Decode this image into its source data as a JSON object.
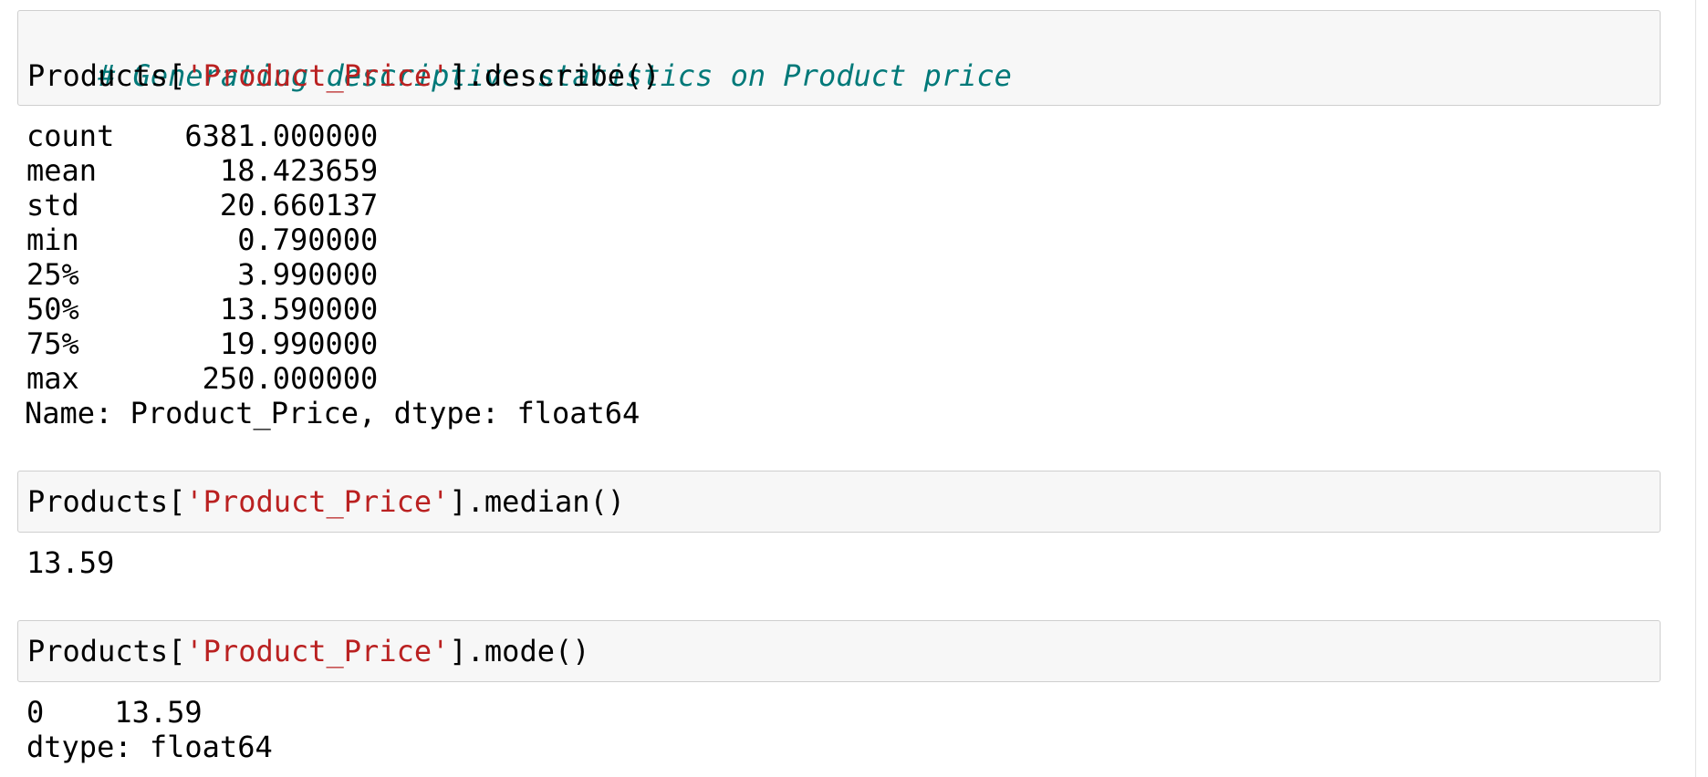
{
  "cell1": {
    "comment": "# Generating descriptive statistics on Product price",
    "code_prefix": "Products[",
    "code_string": "'Product_Price'",
    "code_suffix": "].describe()"
  },
  "output1": {
    "rows": [
      "count    6381.000000",
      "mean       18.423659",
      "std        20.660137",
      "min         0.790000",
      "25%         3.990000",
      "50%        13.590000",
      "75%        19.990000",
      "max       250.000000"
    ],
    "footer": "Name: Product_Price, dtype: float64"
  },
  "cell2": {
    "code_prefix": "Products[",
    "code_string": "'Product_Price'",
    "code_suffix": "].median()"
  },
  "output2": {
    "value": "13.59"
  },
  "cell3": {
    "code_prefix": "Products[",
    "code_string": "'Product_Price'",
    "code_suffix": "].mode()"
  },
  "output3": {
    "row": "0    13.59",
    "footer": "dtype: float64"
  },
  "colors": {
    "comment": "#007979",
    "string": "#ba2121",
    "cell_background": "#f7f7f7",
    "cell_border": "#cfcfcf"
  }
}
